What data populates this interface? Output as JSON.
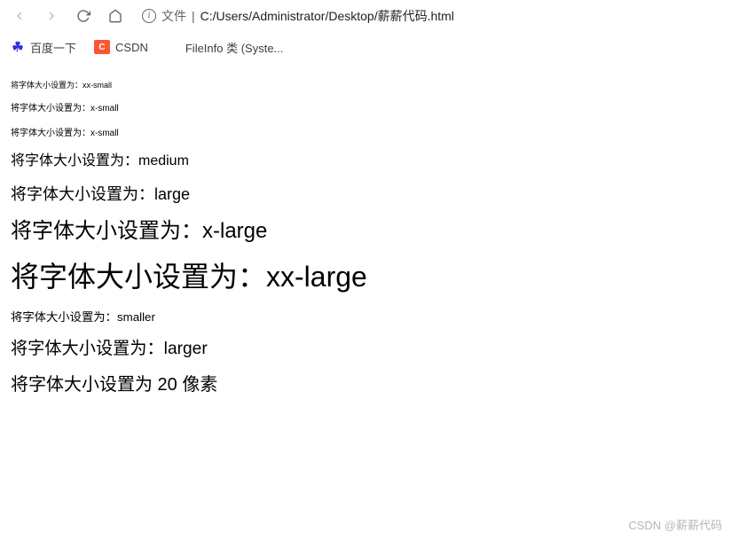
{
  "toolbar": {
    "address_prefix": "文件",
    "address_separator": "|",
    "address_path": "C:/Users/Administrator/Desktop/薪薪代码.html"
  },
  "bookmarks": {
    "items": [
      {
        "label": "百度一下",
        "icon": "baidu"
      },
      {
        "label": "CSDN",
        "icon": "csdn"
      },
      {
        "label": "FileInfo 类 (Syste...",
        "icon": "microsoft"
      }
    ]
  },
  "content": {
    "lines": [
      {
        "text": "将字体大小设置为：xx-small",
        "class": "fs-xx-small"
      },
      {
        "text": "将字体大小设置为：x-small",
        "class": "fs-x-small"
      },
      {
        "text": "将字体大小设置为：x-small",
        "class": "fs-x-small"
      },
      {
        "text": "将字体大小设置为：medium",
        "class": "fs-medium"
      },
      {
        "text": "将字体大小设置为：large",
        "class": "fs-large"
      },
      {
        "text": "将字体大小设置为：x-large",
        "class": "fs-x-large"
      },
      {
        "text": "将字体大小设置为：xx-large",
        "class": "fs-xx-large"
      },
      {
        "text": "将字体大小设置为：smaller",
        "class": "fs-smaller"
      },
      {
        "text": "将字体大小设置为：larger",
        "class": "fs-larger"
      },
      {
        "text": "将字体大小设置为 20 像素",
        "class": "fs-20"
      }
    ]
  },
  "watermark": "CSDN @薪薪代码"
}
